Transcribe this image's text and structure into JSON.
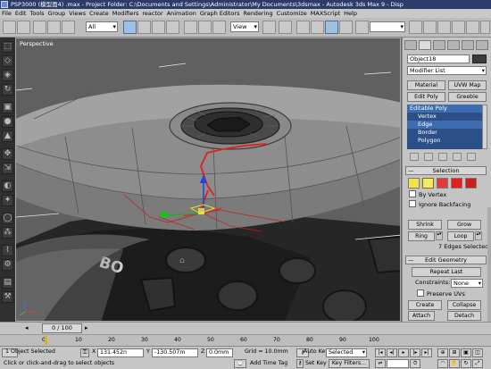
{
  "window": {
    "title": "PSP3000 (模型面4) .max   - Project Folder: C:\\Documents and Settings\\Administrator\\My Documents\\3dsmax   - Autodesk 3ds Max 9   - Disp"
  },
  "menu": [
    "File",
    "Edit",
    "Tools",
    "Group",
    "Views",
    "Create",
    "Modifiers",
    "reactor",
    "Animation",
    "Graph Editors",
    "Rendering",
    "Customize",
    "MAXScript",
    "Help"
  ],
  "toolbar": {
    "selection_filter": "All",
    "ref_coord": "View",
    "named_selection": ""
  },
  "viewport": {
    "label": "Perspective"
  },
  "command_panel": {
    "object_name": "Object18",
    "modifier_list": "Modifier List",
    "buttons": {
      "material": "Material",
      "uvw_map": "UVW Map",
      "edit_poly": "Edit Poly",
      "greeble": "Greeble"
    },
    "stack": [
      {
        "label": "Editable Poly",
        "level": 0,
        "highlight": true
      },
      {
        "label": "Vertex",
        "level": 1,
        "highlight": false
      },
      {
        "label": "Edge",
        "level": 1,
        "highlight": true
      },
      {
        "label": "Border",
        "level": 1,
        "highlight": false
      },
      {
        "label": "Polygon",
        "level": 1,
        "highlight": false
      }
    ],
    "selection": {
      "title": "Selection",
      "by_vertex": "By Vertex",
      "ignore_backfacing": "Ignore Backfacing",
      "shrink": "Shrink",
      "grow": "Grow",
      "ring": "Ring",
      "loop": "Loop",
      "status": "7 Edges Selected"
    },
    "edit_geometry": {
      "title": "Edit Geometry",
      "repeat_last": "Repeat Last",
      "constraints_label": "Constraints:",
      "constraints_value": "None",
      "preserve_uvs": "Preserve UVs",
      "create": "Create",
      "collapse": "Collapse",
      "attach": "Attach",
      "detach": "Detach",
      "slice_plane": "Slice Plane",
      "split": "Split"
    }
  },
  "timeline": {
    "frame": "0 / 100",
    "ticks": [
      "0",
      "10",
      "20",
      "30",
      "40",
      "50",
      "60",
      "70",
      "80",
      "90",
      "100"
    ]
  },
  "status": {
    "objects": "1 Object Selected",
    "prompt": "Click or click-and-drag to select objects",
    "x_label": "X",
    "x_value": "131.452n",
    "y_label": "Y",
    "y_value": "-130.507m",
    "z_label": "Z",
    "z_value": "0.0mm",
    "grid": "Grid = 10.0mm",
    "add_time_tag": "Add Time Tag",
    "auto_key": "Auto Key",
    "set_key": "Set Key",
    "key_mode": "Selected",
    "key_filters": "Key Filters..."
  },
  "colors": {
    "title_bg": "#2b3b6a",
    "selection_bg": "#2b4f86",
    "selected_edge": "#e02020"
  }
}
